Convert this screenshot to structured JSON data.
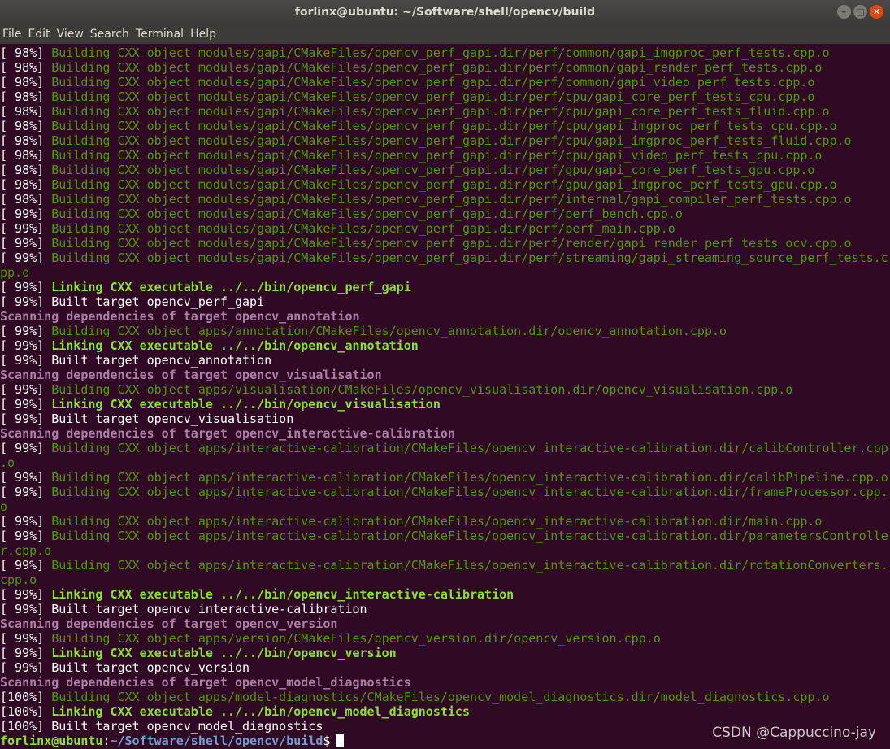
{
  "window": {
    "title": "forlinx@ubuntu: ~/Software/shell/opencv/build",
    "btn_minimize": "–",
    "btn_maximize": "□",
    "btn_close": "✕"
  },
  "menu": [
    "File",
    "Edit",
    "View",
    "Search",
    "Terminal",
    "Help"
  ],
  "colors": {
    "background": "#300a24",
    "building": "#4e9a06",
    "linking": "#8ae234",
    "scanning": "#ad7fa8",
    "prompt_user": "#8ae234",
    "prompt_path": "#729fcf"
  },
  "lines": [
    {
      "p": "[ 98%] ",
      "t": "Building CXX object modules/gapi/CMakeFiles/opencv_perf_gapi.dir/perf/common/gapi_imgproc_perf_tests.cpp.o",
      "s": "green"
    },
    {
      "p": "[ 98%] ",
      "t": "Building CXX object modules/gapi/CMakeFiles/opencv_perf_gapi.dir/perf/common/gapi_render_perf_tests.cpp.o",
      "s": "green"
    },
    {
      "p": "[ 98%] ",
      "t": "Building CXX object modules/gapi/CMakeFiles/opencv_perf_gapi.dir/perf/common/gapi_video_perf_tests.cpp.o",
      "s": "green"
    },
    {
      "p": "[ 98%] ",
      "t": "Building CXX object modules/gapi/CMakeFiles/opencv_perf_gapi.dir/perf/cpu/gapi_core_perf_tests_cpu.cpp.o",
      "s": "green"
    },
    {
      "p": "[ 98%] ",
      "t": "Building CXX object modules/gapi/CMakeFiles/opencv_perf_gapi.dir/perf/cpu/gapi_core_perf_tests_fluid.cpp.o",
      "s": "green"
    },
    {
      "p": "[ 98%] ",
      "t": "Building CXX object modules/gapi/CMakeFiles/opencv_perf_gapi.dir/perf/cpu/gapi_imgproc_perf_tests_cpu.cpp.o",
      "s": "green"
    },
    {
      "p": "[ 98%] ",
      "t": "Building CXX object modules/gapi/CMakeFiles/opencv_perf_gapi.dir/perf/cpu/gapi_imgproc_perf_tests_fluid.cpp.o",
      "s": "green"
    },
    {
      "p": "[ 98%] ",
      "t": "Building CXX object modules/gapi/CMakeFiles/opencv_perf_gapi.dir/perf/cpu/gapi_video_perf_tests_cpu.cpp.o",
      "s": "green"
    },
    {
      "p": "[ 98%] ",
      "t": "Building CXX object modules/gapi/CMakeFiles/opencv_perf_gapi.dir/perf/gpu/gapi_core_perf_tests_gpu.cpp.o",
      "s": "green"
    },
    {
      "p": "[ 98%] ",
      "t": "Building CXX object modules/gapi/CMakeFiles/opencv_perf_gapi.dir/perf/gpu/gapi_imgproc_perf_tests_gpu.cpp.o",
      "s": "green"
    },
    {
      "p": "[ 98%] ",
      "t": "Building CXX object modules/gapi/CMakeFiles/opencv_perf_gapi.dir/perf/internal/gapi_compiler_perf_tests.cpp.o",
      "s": "green"
    },
    {
      "p": "[ 99%] ",
      "t": "Building CXX object modules/gapi/CMakeFiles/opencv_perf_gapi.dir/perf/perf_bench.cpp.o",
      "s": "green"
    },
    {
      "p": "[ 99%] ",
      "t": "Building CXX object modules/gapi/CMakeFiles/opencv_perf_gapi.dir/perf/perf_main.cpp.o",
      "s": "green"
    },
    {
      "p": "[ 99%] ",
      "t": "Building CXX object modules/gapi/CMakeFiles/opencv_perf_gapi.dir/perf/render/gapi_render_perf_tests_ocv.cpp.o",
      "s": "green"
    },
    {
      "p": "[ 99%] ",
      "t": "Building CXX object modules/gapi/CMakeFiles/opencv_perf_gapi.dir/perf/streaming/gapi_streaming_source_perf_tests.c",
      "s": "green"
    },
    {
      "p": "",
      "t": "pp.o",
      "s": "green"
    },
    {
      "p": "[ 99%] ",
      "t": "Linking CXX executable ../../bin/opencv_perf_gapi",
      "s": "bgreen"
    },
    {
      "p": "[ 99%] ",
      "t": "Built target opencv_perf_gapi",
      "s": "plain"
    },
    {
      "p": "",
      "t": "Scanning dependencies of target opencv_annotation",
      "s": "magenta"
    },
    {
      "p": "[ 99%] ",
      "t": "Building CXX object apps/annotation/CMakeFiles/opencv_annotation.dir/opencv_annotation.cpp.o",
      "s": "green"
    },
    {
      "p": "[ 99%] ",
      "t": "Linking CXX executable ../../bin/opencv_annotation",
      "s": "bgreen"
    },
    {
      "p": "[ 99%] ",
      "t": "Built target opencv_annotation",
      "s": "plain"
    },
    {
      "p": "",
      "t": "Scanning dependencies of target opencv_visualisation",
      "s": "magenta"
    },
    {
      "p": "[ 99%] ",
      "t": "Building CXX object apps/visualisation/CMakeFiles/opencv_visualisation.dir/opencv_visualisation.cpp.o",
      "s": "green"
    },
    {
      "p": "[ 99%] ",
      "t": "Linking CXX executable ../../bin/opencv_visualisation",
      "s": "bgreen"
    },
    {
      "p": "[ 99%] ",
      "t": "Built target opencv_visualisation",
      "s": "plain"
    },
    {
      "p": "",
      "t": "Scanning dependencies of target opencv_interactive-calibration",
      "s": "magenta"
    },
    {
      "p": "[ 99%] ",
      "t": "Building CXX object apps/interactive-calibration/CMakeFiles/opencv_interactive-calibration.dir/calibController.cpp",
      "s": "green"
    },
    {
      "p": "",
      "t": ".o",
      "s": "green"
    },
    {
      "p": "[ 99%] ",
      "t": "Building CXX object apps/interactive-calibration/CMakeFiles/opencv_interactive-calibration.dir/calibPipeline.cpp.o",
      "s": "green"
    },
    {
      "p": "[ 99%] ",
      "t": "Building CXX object apps/interactive-calibration/CMakeFiles/opencv_interactive-calibration.dir/frameProcessor.cpp.",
      "s": "green"
    },
    {
      "p": "",
      "t": "o",
      "s": "green"
    },
    {
      "p": "[ 99%] ",
      "t": "Building CXX object apps/interactive-calibration/CMakeFiles/opencv_interactive-calibration.dir/main.cpp.o",
      "s": "green"
    },
    {
      "p": "[ 99%] ",
      "t": "Building CXX object apps/interactive-calibration/CMakeFiles/opencv_interactive-calibration.dir/parametersControlle",
      "s": "green"
    },
    {
      "p": "",
      "t": "r.cpp.o",
      "s": "green"
    },
    {
      "p": "[ 99%] ",
      "t": "Building CXX object apps/interactive-calibration/CMakeFiles/opencv_interactive-calibration.dir/rotationConverters.",
      "s": "green"
    },
    {
      "p": "",
      "t": "cpp.o",
      "s": "green"
    },
    {
      "p": "[ 99%] ",
      "t": "Linking CXX executable ../../bin/opencv_interactive-calibration",
      "s": "bgreen"
    },
    {
      "p": "[ 99%] ",
      "t": "Built target opencv_interactive-calibration",
      "s": "plain"
    },
    {
      "p": "",
      "t": "Scanning dependencies of target opencv_version",
      "s": "magenta"
    },
    {
      "p": "[ 99%] ",
      "t": "Building CXX object apps/version/CMakeFiles/opencv_version.dir/opencv_version.cpp.o",
      "s": "green"
    },
    {
      "p": "[ 99%] ",
      "t": "Linking CXX executable ../../bin/opencv_version",
      "s": "bgreen"
    },
    {
      "p": "[ 99%] ",
      "t": "Built target opencv_version",
      "s": "plain"
    },
    {
      "p": "",
      "t": "Scanning dependencies of target opencv_model_diagnostics",
      "s": "magenta"
    },
    {
      "p": "[100%] ",
      "t": "Building CXX object apps/model-diagnostics/CMakeFiles/opencv_model_diagnostics.dir/model_diagnostics.cpp.o",
      "s": "green"
    },
    {
      "p": "[100%] ",
      "t": "Linking CXX executable ../../bin/opencv_model_diagnostics",
      "s": "bgreen"
    },
    {
      "p": "[100%] ",
      "t": "Built target opencv_model_diagnostics",
      "s": "plain"
    }
  ],
  "prompt": {
    "user": "forlinx@ubuntu",
    "sep": ":",
    "path": "~/Software/shell/opencv/build",
    "symbol": "$"
  },
  "watermark": "CSDN @Cappuccino-jay"
}
